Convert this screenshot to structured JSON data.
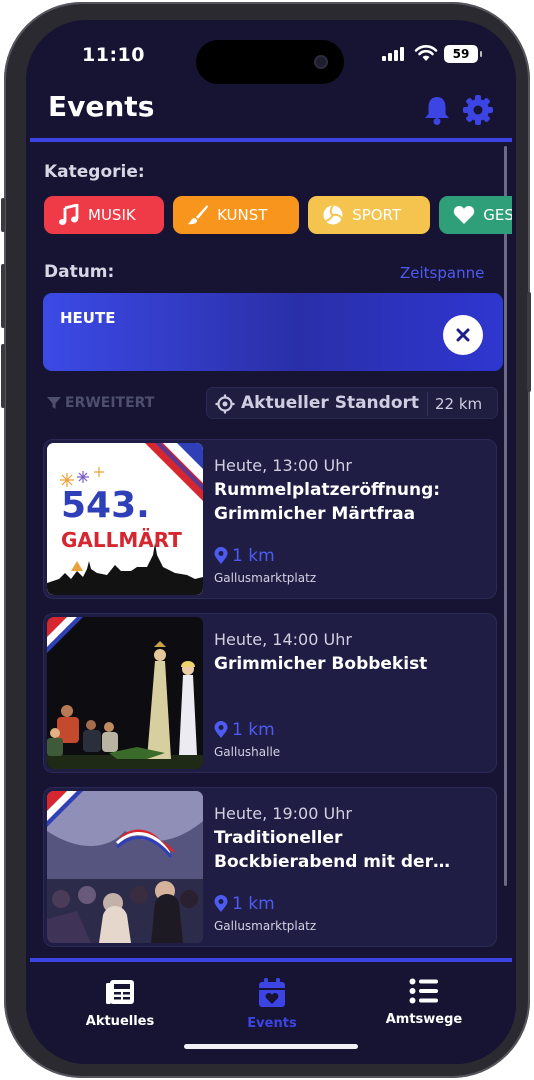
{
  "status_bar": {
    "time": "11:10",
    "battery": "59"
  },
  "header": {
    "title": "Events",
    "bell_icon": "bell-icon",
    "settings_icon": "gear-icon"
  },
  "category": {
    "label": "Kategorie:",
    "chips": [
      {
        "label": "MUSIK",
        "icon": "music-note-icon",
        "color": "#ef3b48"
      },
      {
        "label": "KUNST",
        "icon": "paintbrush-icon",
        "color": "#f7951d"
      },
      {
        "label": "SPORT",
        "icon": "volleyball-icon",
        "color": "#f5c44e"
      },
      {
        "label": "GESU",
        "icon": "heart-icon",
        "color": "#2f9f7a"
      }
    ]
  },
  "date": {
    "label": "Datum:",
    "range_link": "Zeitspanne",
    "value": "HEUTE"
  },
  "filters": {
    "advanced": "ERWEITERT",
    "location": "Aktueller Standort",
    "radius": "22 km"
  },
  "events": [
    {
      "when": "Heute, 13:00 Uhr",
      "title": "Rummelplatzeröffnung: Grimmicher Märtfraa",
      "distance": "1 km",
      "venue": "Gallusmarktplatz",
      "image_text_1": "543.",
      "image_text_2": "GALLMÄRT"
    },
    {
      "when": "Heute, 14:00 Uhr",
      "title": "Grimmicher Bobbekist",
      "distance": "1 km",
      "venue": "Gallushalle"
    },
    {
      "when": "Heute, 19:00 Uhr",
      "title": "Traditioneller Bockbierabend mit der…",
      "distance": "1 km",
      "venue": "Gallusmarktplatz"
    }
  ],
  "tabbar": {
    "tabs": [
      {
        "label": "Aktuelles",
        "icon": "newspaper-icon"
      },
      {
        "label": "Events",
        "icon": "calendar-heart-icon"
      },
      {
        "label": "Amtswege",
        "icon": "list-icon"
      }
    ]
  },
  "colors": {
    "accent": "#3d44e4",
    "background": "#161432",
    "card": "#1f1d44"
  }
}
